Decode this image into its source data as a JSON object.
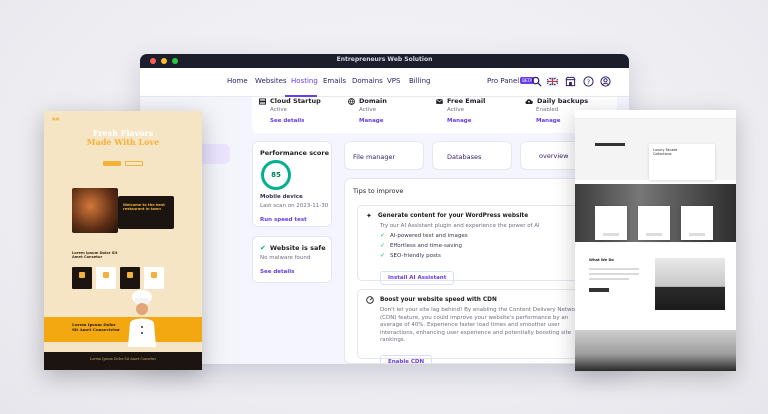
{
  "window": {
    "title": "Entrepreneurs Web Solution"
  },
  "nav": {
    "items": [
      "Home",
      "Websites",
      "Hosting",
      "Emails",
      "Domains",
      "VPS",
      "Billing"
    ],
    "active": "Hosting",
    "pro_panel": "Pro Panel",
    "beta": "BETA"
  },
  "services": [
    {
      "name": "Cloud Startup",
      "status": "Active",
      "link": "See details",
      "icon": "hosting-icon"
    },
    {
      "name": "Domain",
      "status": "Active",
      "link": "Manage",
      "icon": "globe-icon"
    },
    {
      "name": "Free Email",
      "status": "Active",
      "link": "Manage",
      "icon": "mail-icon"
    },
    {
      "name": "Daily backups",
      "status": "Enabled",
      "link": "Manage",
      "icon": "cloud-upload-icon"
    }
  ],
  "performance": {
    "title": "Performance score",
    "score": "85",
    "device": "Mobile device",
    "last_scan": "Last scan on 2023-11-30",
    "link": "Run speed test"
  },
  "safe": {
    "title": "Website is safe",
    "subtitle": "No malware found",
    "link": "See details"
  },
  "quick": [
    "File manager",
    "Databases",
    "overview"
  ],
  "tips": {
    "title": "Tips to improve",
    "tip1": {
      "title": "Generate content for your WordPress website",
      "desc": "Try our AI Assistant plugin and experience the power of AI",
      "bullets": [
        "AI-powered text and images",
        "Effortless and time-saving",
        "SEO-friendly posts"
      ],
      "button": "Install AI Assistant"
    },
    "tip2": {
      "title": "Boost your website speed with CDN",
      "desc": "Don't let your site lag behind! By enabling the Content Delivery Network (CDN) feature, you could improve your website's performance by an average of 40%. Experience faster load times and smoother user interactions, enhancing user experience and potentially boosting site rankings.",
      "button": "Enable CDN"
    }
  },
  "restaurant": {
    "headline1": "Fresh Flavors",
    "headline2": "Made With Love",
    "welcome": "Welcome to the best restaurant in town",
    "lorem": "Lorem Ipsum Dolor Sit Amet Consetur",
    "band": "Lorem Ipsum Dolor Sit Amet Consectetur",
    "footer": "Lorem Ipsum Dolor Sit Amet Consetur"
  },
  "architecture": {
    "hero": "Luxury Facade Collections",
    "section": "What We Do"
  },
  "colors": {
    "accent": "#673de6",
    "success": "#00b090",
    "dark": "#1d1e2c"
  }
}
